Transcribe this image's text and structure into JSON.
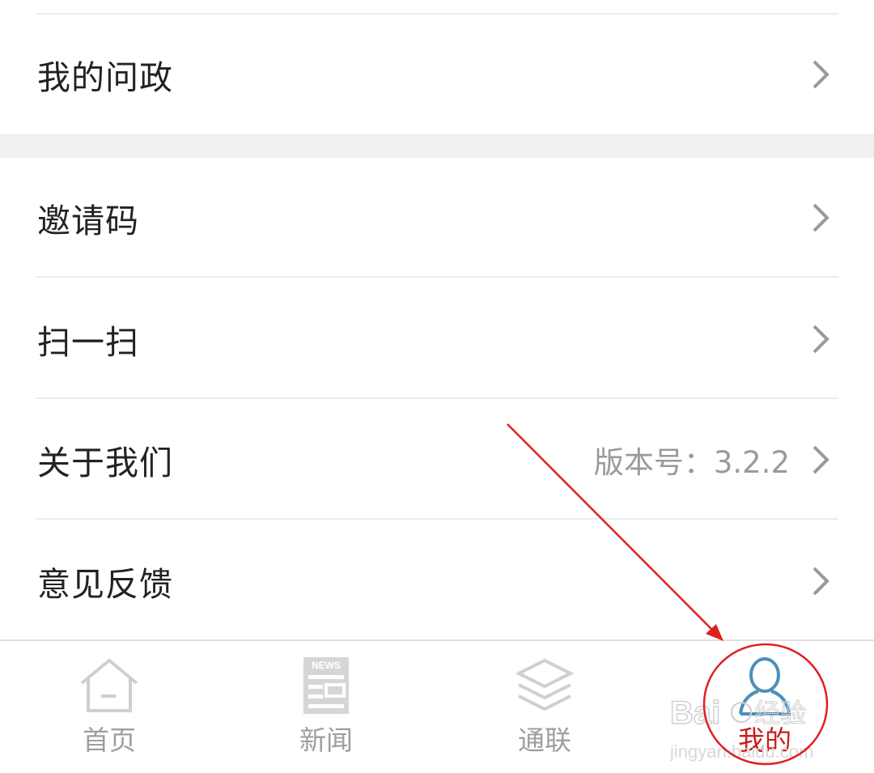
{
  "menu": {
    "items": [
      {
        "label": "我的问政",
        "value": ""
      },
      {
        "label": "邀请码",
        "value": ""
      },
      {
        "label": "扫一扫",
        "value": ""
      },
      {
        "label": "关于我们",
        "value": "版本号：3.2.2"
      },
      {
        "label": "意见反馈",
        "value": ""
      }
    ]
  },
  "tabbar": {
    "tabs": [
      {
        "label": "首页",
        "icon": "home-icon",
        "active": false
      },
      {
        "label": "新闻",
        "icon": "news-icon",
        "active": false,
        "icon_text": "NEWS"
      },
      {
        "label": "通联",
        "icon": "layers-icon",
        "active": false
      },
      {
        "label": "我的",
        "icon": "user-icon",
        "active": true
      }
    ]
  },
  "watermark": {
    "brand": "Bai",
    "brand2": "经验",
    "url": "jingyan.baidu.com"
  },
  "colors": {
    "accent": "#c81e1e",
    "icon_gray": "#cfcfcf",
    "active_icon": "#4a90b8",
    "annotation": "#e02020"
  }
}
